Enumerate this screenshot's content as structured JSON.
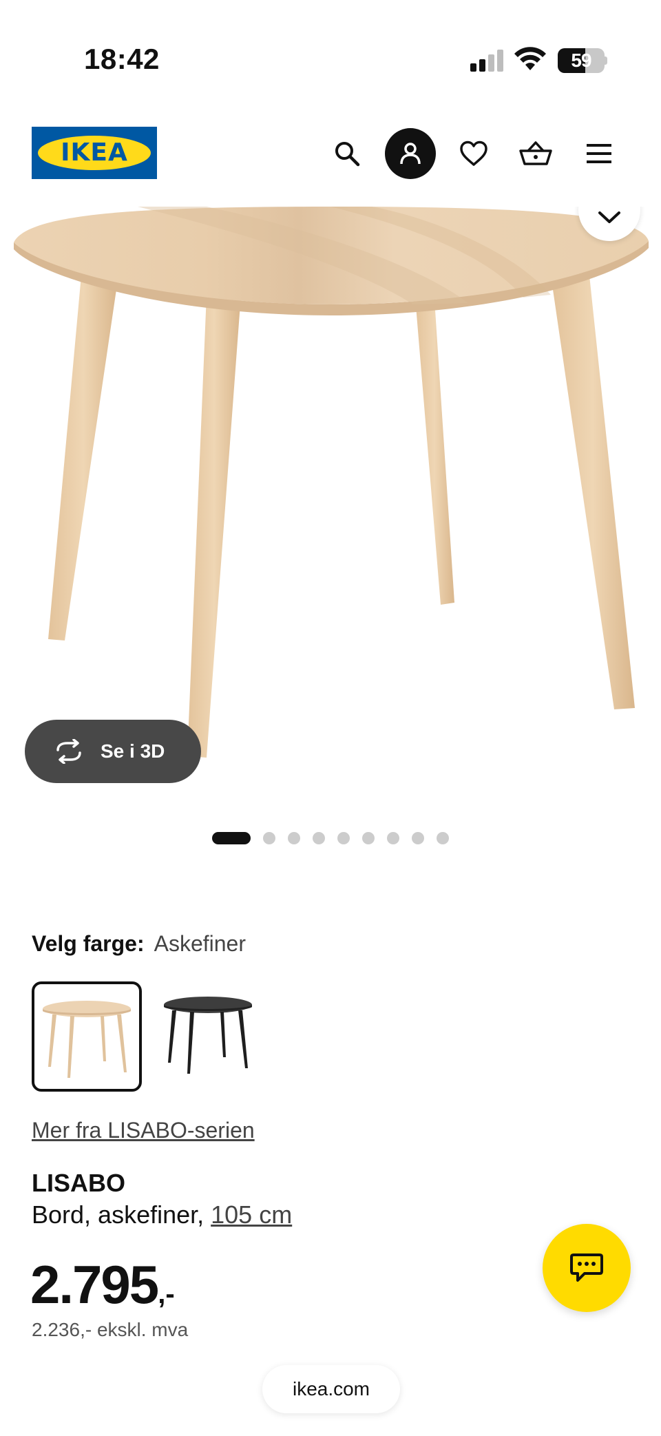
{
  "status_bar": {
    "time": "18:42",
    "battery_percent": "59",
    "battery_level": 0.59
  },
  "header": {
    "logo_text": "IKEA",
    "icons": [
      "search-icon",
      "profile-icon",
      "heart-icon",
      "basket-icon",
      "menu-icon"
    ]
  },
  "gallery": {
    "view_3d_label": "Se i 3D",
    "dot_count": 9,
    "active_dot": 0
  },
  "color": {
    "label": "Velg farge:",
    "selected": "Askefiner",
    "swatches": [
      "Askefiner",
      "Svart"
    ]
  },
  "series_link": "Mer fra LISABO-serien",
  "product": {
    "name": "LISABO",
    "description": "Bord, askefiner, ",
    "size": "105 cm",
    "price_main": "2.795",
    "price_suffix": ",-",
    "price_ex_vat": "2.236,- ekskl. mva"
  },
  "browser": {
    "url": "ikea.com"
  },
  "colors": {
    "ikea_blue": "#0058a3",
    "ikea_yellow": "#ffda1a",
    "chat_yellow": "#ffdb00"
  }
}
